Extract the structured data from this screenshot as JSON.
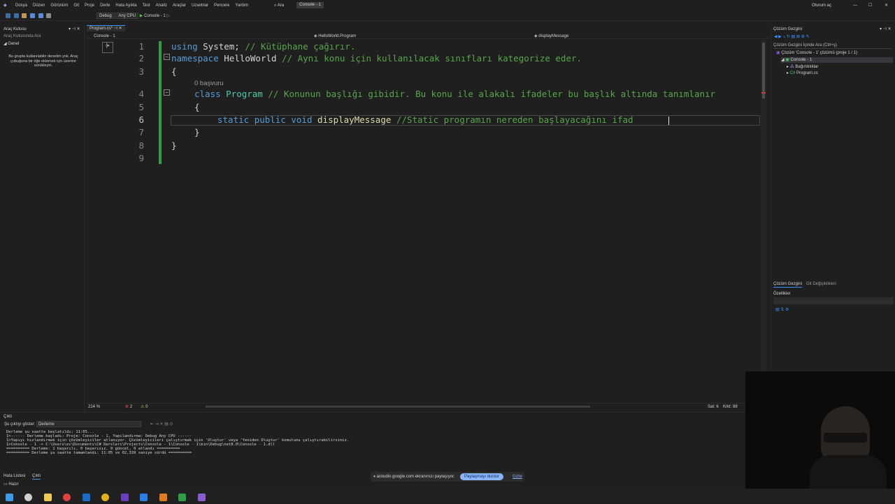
{
  "titlebar": {
    "menus": [
      "Dosya",
      "Düzen",
      "Görünüm",
      "Git",
      "Proje",
      "Derle",
      "Hata Ayıkla",
      "Test",
      "Analiz",
      "Araçlar",
      "Uzantılar",
      "Pencere",
      "Yardım"
    ],
    "search_label": "Ara",
    "solution_name": "Console - 1",
    "user_label": "Oturum aç"
  },
  "toolbar": {
    "configuration": "Debug",
    "platform": "Any CPU",
    "run_target": "Console - 1"
  },
  "left_panel": {
    "title": "Araç Kutusu",
    "search_placeholder": "Araç Kutusunda Ara",
    "group": "Genel",
    "empty_message": "Bu grupta kullanılabilir denetim yok. Araç çubuğuna bir öğe eklemek için üzerine sürükleyin."
  },
  "editor": {
    "tab_label": "Program.cs*",
    "nav_project": "Console - 1",
    "nav_class": "HelloWorld.Program",
    "nav_member": "displayMessage",
    "codelens": "0 başvuru",
    "lines": [
      {
        "no": "1",
        "tokens": [
          {
            "t": "using ",
            "c": "kw"
          },
          {
            "t": "System;",
            "c": "id"
          },
          {
            "t": " // Kütüphane çağırır.",
            "c": "cm"
          }
        ]
      },
      {
        "no": "2",
        "tokens": [
          {
            "t": "namespace ",
            "c": "kw"
          },
          {
            "t": "HelloWorld",
            "c": "id"
          },
          {
            "t": " // Aynı konu için kullanılacak sınıfları kategorize eder.",
            "c": "cm"
          }
        ]
      },
      {
        "no": "3",
        "tokens": [
          {
            "t": "{",
            "c": "pl"
          }
        ]
      },
      {
        "no": "4",
        "tokens": [
          {
            "t": "class ",
            "c": "kw"
          },
          {
            "t": "Program",
            "c": "ty"
          },
          {
            "t": " // Konunun başlığı gibidir. Bu konu ile alakalı ifadeler bu başlık altında tanımlanır",
            "c": "cm"
          }
        ]
      },
      {
        "no": "5",
        "tokens": [
          {
            "t": "{",
            "c": "pl"
          }
        ]
      },
      {
        "no": "6",
        "tokens": [
          {
            "t": "static ",
            "c": "kw"
          },
          {
            "t": "public ",
            "c": "kw"
          },
          {
            "t": "void ",
            "c": "kw"
          },
          {
            "t": "displayMessage",
            "c": "fn"
          },
          {
            "t": " //Static programın nereden başlayacağını ifad",
            "c": "cm"
          }
        ]
      },
      {
        "no": "7",
        "tokens": [
          {
            "t": "}",
            "c": "pl"
          }
        ]
      },
      {
        "no": "8",
        "tokens": [
          {
            "t": "}",
            "c": "pl"
          }
        ]
      },
      {
        "no": "9",
        "tokens": []
      }
    ]
  },
  "editor_status": {
    "zoom": "214 %",
    "errors": "2",
    "warnings": "0",
    "position": "Sat: 6",
    "column": "Krkt: 88"
  },
  "right_panel": {
    "title": "Çözüm Gezgini",
    "search_placeholder": "Çözüm Gezgini İçinde Ara (Ctrl+ş)",
    "solution_node": "Çözüm 'Console - 1' çözümü (proje 1 / 1)",
    "project_node": "Console - 1",
    "dependencies_node": "Bağımlılıklar",
    "file_node": "Program.cs",
    "tab1": "Çözüm Gezgini",
    "tab2": "Git Değişiklikleri",
    "properties_title": "Özellikler"
  },
  "output": {
    "title": "Çıktı",
    "show_from_label": "Şu çıktıyı göster:",
    "show_from_value": "Derleme",
    "lines": [
      "Derleme şu saatte başlatıldı: 11:05...",
      "1>------ Derleme başladı: Proje: Console - 1, Yapılandırma: Debug Any CPU ------",
      "1>Yapıyı hızlandırmak için çözümleyiciler atlanıyor. Çözümleyicileri çalıştırmak için 'Oluştur' veya 'Yeniden Oluştur' komutunu çalıştırabilirsiniz.",
      "1>Console - 1 -> C:\\Users\\ec\\Documents\\C# Dersleri\\Projects\\Console - 1\\Console - 1\\bin\\Debug\\net8.0\\Console - 1.dll",
      "========== Derleme: 1 başarılı, 0 başarısız, 0 güncel, 0 atlandı ==========",
      "========== Derleme şu saatte tamamlandı: 11:05 ve 02,339 saniye sürdü =========="
    ],
    "tab_errors": "Hata Listesi",
    "tab_output": "Çıktı"
  },
  "status_bottom": {
    "ready": "Hazır"
  },
  "share_bar": {
    "message": "aistudio.google.com ekranınızı paylaşıyor.",
    "stop_label": "Paylaşmayı durdur",
    "hide_label": "Gizle"
  },
  "colors": {
    "accent": "#3794ff",
    "keyword": "#569cd6",
    "type": "#4ec9b0",
    "comment": "#57a64a",
    "method": "#dcdcaa",
    "vs_purple": "#8a5cd1"
  }
}
